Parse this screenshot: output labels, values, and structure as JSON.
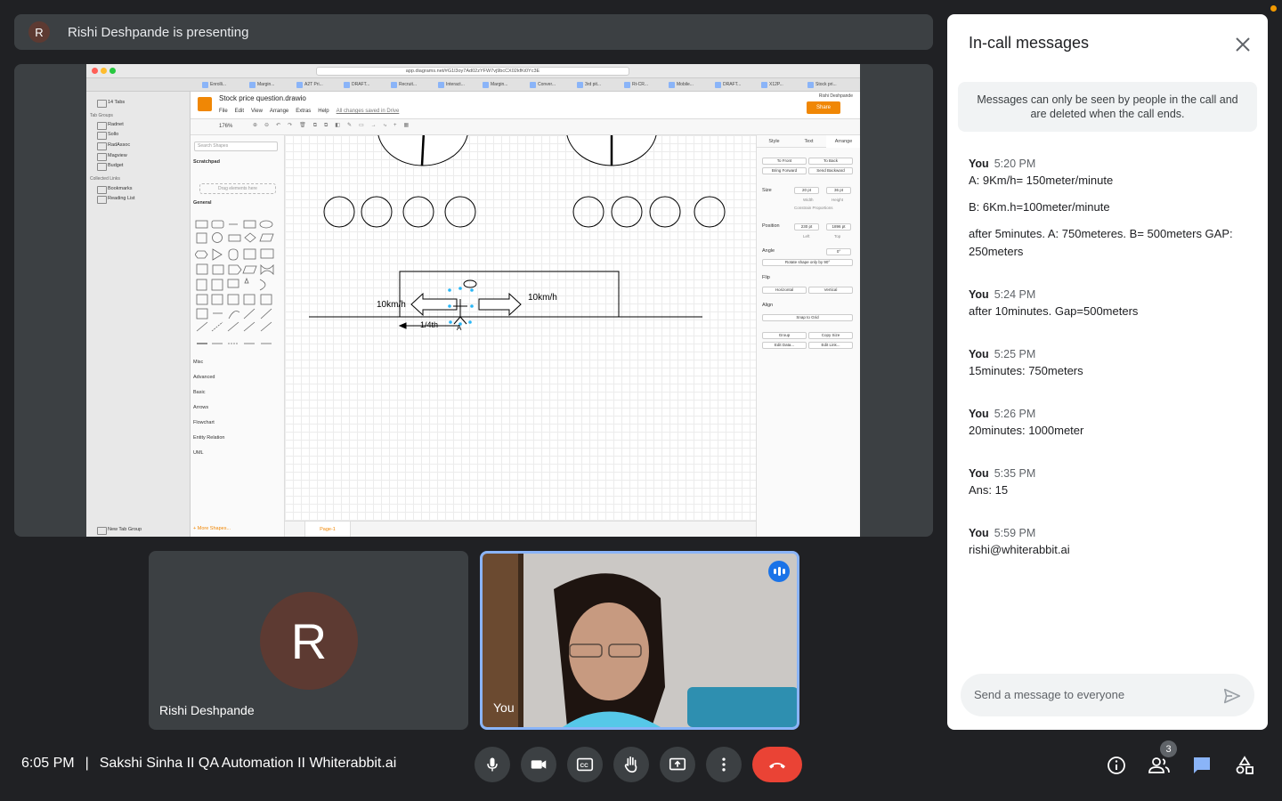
{
  "presenter": {
    "avatar_letter": "R",
    "text": "Rishi Deshpande is presenting"
  },
  "shared_screen": {
    "url": "app.diagrams.net/#G1l3oy7Ad02zYFW7vj9bcCX02kfKi0Yc3E",
    "browser_tabs": [
      "Enrolli...",
      "Margin...",
      "A2T Pri...",
      "DRAFT...",
      "Recruit...",
      "Interact...",
      "Margin...",
      "Conver...",
      "3rd pit...",
      "Rt-CR...",
      "Mobile...",
      "DRAFT...",
      "X12P...",
      "Stock pri..."
    ],
    "sidebar": {
      "tabs_label": "14 Tabs",
      "group_heading": "Tab Groups",
      "groups": [
        "Radnet",
        "Sollo",
        "RadAssoc",
        "Magview",
        "Budget"
      ],
      "collected_heading": "Collected Links",
      "links": [
        "Bookmarks",
        "Reading List"
      ],
      "new_tab_group": "New Tab Group"
    },
    "drawio": {
      "title": "Stock price question.drawio",
      "menu": [
        "File",
        "Edit",
        "View",
        "Arrange",
        "Extras",
        "Help"
      ],
      "saved_text": "All changes saved in Drive",
      "user": "Rishi Deshpande",
      "share_label": "Share",
      "zoom": "176%",
      "search_placeholder": "Search Shapes",
      "scratchpad": "Scratchpad",
      "drag_hint": "Drag elements here",
      "general": "General",
      "libraries": [
        "Misc",
        "Advanced",
        "Basic",
        "Arrows",
        "Flowchart",
        "Entity Relation",
        "UML"
      ],
      "more_shapes": "+ More Shapes...",
      "page_tab": "Page-1",
      "canvas_labels": {
        "left_speed": "10km/h",
        "right_speed": "10km/h",
        "quarter": "1/4th",
        "point_a": "A"
      },
      "right_tabs": [
        "Style",
        "Text",
        "Arrange"
      ],
      "arrange": {
        "to_front": "To Front",
        "to_back": "To Back",
        "bring_forward": "Bring Forward",
        "send_backward": "Send Backward",
        "size_label": "Size",
        "width_val": "20 pt",
        "height_val": "36 pt",
        "width_label": "Width",
        "height_label": "Height",
        "constrain": "Constrain Proportions",
        "position_label": "Position",
        "left_val": "230 pt",
        "top_val": "1896 pt",
        "left_label": "Left",
        "top_label": "Top",
        "angle_label": "Angle",
        "angle_val": "0°",
        "rotate": "Rotate shape only by 90°",
        "flip_label": "Flip",
        "horizontal": "Horizontal",
        "vertical": "Vertical",
        "align_label": "Align",
        "snap": "Snap to Grid",
        "group": "Group",
        "copy_size": "Copy Size",
        "edit_data": "Edit Data...",
        "edit_link": "Edit Link..."
      }
    }
  },
  "tiles": {
    "rishi": {
      "avatar_letter": "R",
      "name": "Rishi Deshpande"
    },
    "you": {
      "name": "You"
    }
  },
  "chat": {
    "title": "In-call messages",
    "notice": "Messages can only be seen by people in the call and are deleted when the call ends.",
    "messages": [
      {
        "sender": "You",
        "time": "5:20 PM",
        "lines": [
          "A: 9Km/h= 150meter/minute",
          "B: 6Km.h=100meter/minute",
          "after 5minutes. A: 750meteres. B= 500meters GAP: 250meters"
        ]
      },
      {
        "sender": "You",
        "time": "5:24 PM",
        "lines": [
          "after 10minutes. Gap=500meters"
        ]
      },
      {
        "sender": "You",
        "time": "5:25 PM",
        "lines": [
          "15minutes: 750meters"
        ]
      },
      {
        "sender": "You",
        "time": "5:26 PM",
        "lines": [
          "20minutes: 1000meter"
        ]
      },
      {
        "sender": "You",
        "time": "5:35 PM",
        "lines": [
          "Ans: 15"
        ]
      },
      {
        "sender": "You",
        "time": "5:59 PM",
        "lines": [
          "rishi@whiterabbit.ai"
        ]
      }
    ],
    "input_placeholder": "Send a message to everyone"
  },
  "bottom_bar": {
    "time": "6:05 PM",
    "separator": "|",
    "meeting_name": "Sakshi Sinha II QA Automation II Whiterabbit.ai",
    "people_count": "3"
  },
  "colors": {
    "end_call": "#ea4335",
    "accent": "#8ab4f8",
    "chat_active": "#8ab4f8",
    "drawio_orange": "#f08705"
  }
}
